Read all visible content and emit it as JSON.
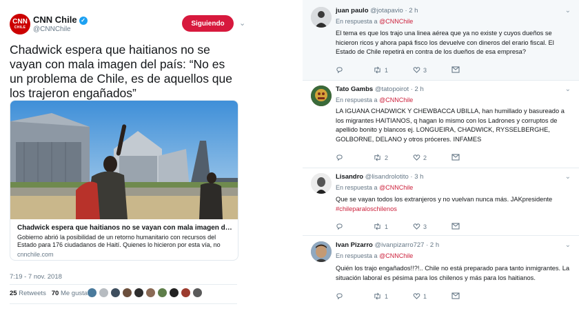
{
  "main_tweet": {
    "author_name": "CNN Chile",
    "author_handle": "@CNNChile",
    "logo_text": "CNN",
    "logo_subtext": "CHILE",
    "follow_label": "Siguiendo",
    "text": "Chadwick espera que haitianos no se vayan con mala imagen del país: “No es un problema de Chile, es de aquellos que los trajeron engañados”",
    "card": {
      "title": "Chadwick espera que haitianos no se vayan con mala imagen del país: “No e...",
      "description": "Gobierno abrió la posibilidad de un retorno humanitario con recursos del Estado para 176 ciudadanos de Haití. Quienes lo hicieron por esta vía, no podrán volver a suel...",
      "domain": "cnnchile.com"
    },
    "timestamp": "7:19 - 7 nov. 2018",
    "retweets_count": "25",
    "retweets_label": "Retweets",
    "likes_count": "70",
    "likes_label": "Me gusta",
    "brand_color": "#cc0000",
    "follow_color": "#d7193d"
  },
  "replies": [
    {
      "name": "juan paulo",
      "handle": "@jotapavio",
      "time": "· 2 h",
      "in_reply_prefix": "En respuesta a",
      "in_reply_mention": "@CNNChile",
      "text": "El tema es que los trajo una linea aérea que ya no existe y cuyos dueños se hicieron ricos y ahora papá fisco los devuelve con dineros del erario fiscal. El Estado de Chile repetirá en contra de los dueños de esa empresa?",
      "replies": "",
      "retweets": "1",
      "likes": "3"
    },
    {
      "name": "Tato Gambs",
      "handle": "@tatopoirot",
      "time": "· 2 h",
      "in_reply_prefix": "En respuesta a",
      "in_reply_mention": "@CNNChile",
      "text": "LA IGUANA CHADWICK Y CHEWBACCA UBILLA, han humillado y basureado a los migrantes HAITIANOS, q hagan lo mismo con los Ladrones y corruptos de apellido bonito y blancos ej. LONGUEIRA, CHADWICK, RYSSELBERGHE, GOLBORNE, DELANO y otros próceres. INFAMES",
      "replies": "",
      "retweets": "2",
      "likes": "2"
    },
    {
      "name": "Lisandro",
      "handle": "@lisandrolotito",
      "time": "· 3 h",
      "in_reply_prefix": "En respuesta a",
      "in_reply_mention": "@CNNChile",
      "text": "Que se vayan todos los extranjeros y no vuelvan nunca más. JAKpresidente",
      "hashtag": "#chileparaloschilenos",
      "replies": "",
      "retweets": "1",
      "likes": "3"
    },
    {
      "name": "Ivan Pizarro",
      "handle": "@ivanpizarro727",
      "time": "· 2 h",
      "in_reply_prefix": "En respuesta a",
      "in_reply_mention": "@CNNChile",
      "text": "Quién los trajo engañados!!?!.. Chile no está preparado para tanto inmigrantes. La situación laboral es pésima para los chilenos y más para los haitianos.",
      "replies": "",
      "retweets": "1",
      "likes": "1"
    }
  ],
  "colors": {
    "mention": "#cc1f3a",
    "muted": "#657786",
    "highlight_bg": "#f5f8fa",
    "verified": "#1da1f2"
  }
}
